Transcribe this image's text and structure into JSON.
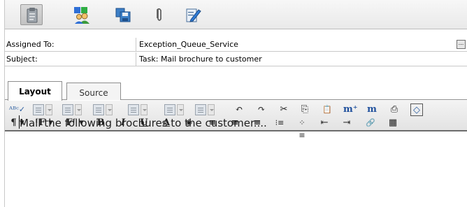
{
  "toolbar": {
    "buttons": [
      {
        "name": "clipboard-icon",
        "pressed": true
      },
      {
        "name": "assign-users-icon",
        "pressed": false
      },
      {
        "name": "save-icon",
        "pressed": false
      },
      {
        "name": "attachment-icon",
        "pressed": false
      },
      {
        "name": "edit-notes-icon",
        "pressed": false
      }
    ]
  },
  "fields": {
    "assigned_to": {
      "label": "Assigned To:",
      "value": "Exception_Queue_Service",
      "lookup_label": "..."
    },
    "subject": {
      "label": "Subject:",
      "value": "Task: Mail brochure to customer"
    }
  },
  "editor": {
    "tabs": [
      {
        "label": "Layout",
        "active": true
      },
      {
        "label": "Source",
        "active": false
      }
    ],
    "body_text": "Mail the following brochures to the customer...."
  },
  "format_toolbar": {
    "row1": [
      {
        "name": "spellcheck-icon",
        "glyph": "ᴬᴮᶜ✓"
      },
      {
        "name": "style-dropdown-1",
        "type": "dropdown"
      },
      {
        "name": "style-dropdown-2",
        "type": "dropdown"
      },
      {
        "name": "style-dropdown-3",
        "type": "dropdown"
      },
      {
        "name": "style-dropdown-4",
        "type": "dropdown"
      },
      {
        "name": "style-dropdown-5",
        "type": "dropdown"
      },
      {
        "name": "style-dropdown-6",
        "type": "dropdown"
      },
      {
        "name": "undo-icon",
        "glyph": "↶"
      },
      {
        "name": "redo-icon",
        "glyph": "↷"
      },
      {
        "name": "cut-icon",
        "glyph": "✂"
      },
      {
        "name": "copy-icon",
        "glyph": "⎘"
      },
      {
        "name": "paste-icon",
        "glyph": "📋"
      },
      {
        "name": "insert-field-icon",
        "glyph": "m⁺"
      },
      {
        "name": "field-markup-icon",
        "glyph": "m"
      },
      {
        "name": "properties-icon",
        "glyph": "⎙"
      },
      {
        "name": "html-source-icon",
        "glyph": "◇"
      }
    ],
    "row2": [
      {
        "name": "paragraph-icon",
        "glyph": "¶ ▾"
      },
      {
        "name": "font-family-icon",
        "glyph": "ᶠF ▾"
      },
      {
        "name": "font-size-icon",
        "glyph": "Fᶠ ▾"
      },
      {
        "name": "bold-icon",
        "glyph": "B"
      },
      {
        "name": "italic-icon",
        "glyph": "I"
      },
      {
        "name": "underline-icon",
        "glyph": "U"
      },
      {
        "name": "font-color-icon",
        "glyph": "A"
      },
      {
        "name": "highlight-icon",
        "glyph": "◈"
      },
      {
        "name": "align-left-icon",
        "glyph": "≡"
      },
      {
        "name": "align-center-icon",
        "glyph": "≡"
      },
      {
        "name": "align-right-icon",
        "glyph": "≡"
      },
      {
        "name": "numbered-list-icon",
        "glyph": "⁝≡"
      },
      {
        "name": "bullet-list-icon",
        "glyph": "⁘≡"
      },
      {
        "name": "outdent-icon",
        "glyph": "⇤"
      },
      {
        "name": "indent-icon",
        "glyph": "⇥"
      },
      {
        "name": "insert-link-icon",
        "glyph": "🔗"
      },
      {
        "name": "insert-table-icon",
        "glyph": "▦"
      }
    ]
  },
  "colors": {
    "toolbar_bg": "#ececec",
    "border": "#8e8e8e",
    "text": "#1d1d1d"
  }
}
